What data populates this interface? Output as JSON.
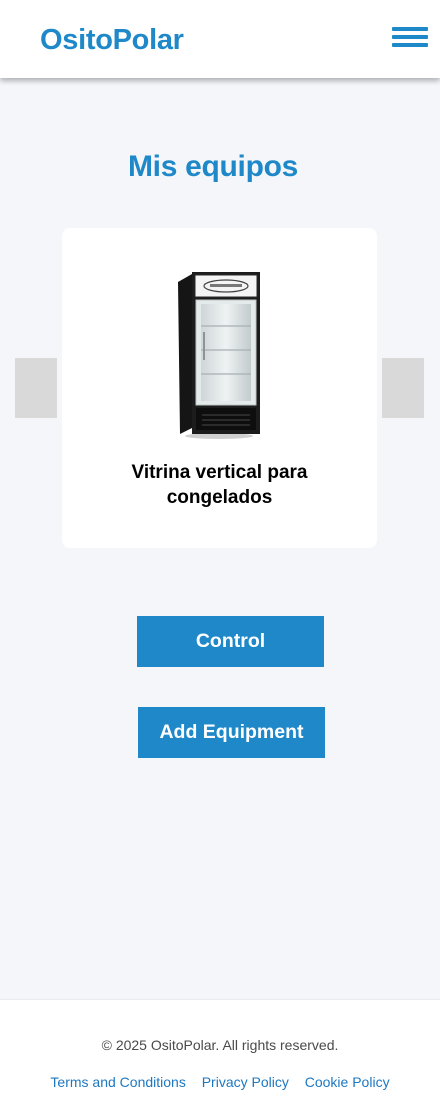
{
  "header": {
    "brand": "OsitoPolar",
    "menu_icon": "hamburger-menu-icon"
  },
  "main": {
    "title": "Mis equipos",
    "carousel": {
      "prev_icon": "chevron-left-icon",
      "next_icon": "chevron-right-icon",
      "current_item": {
        "name": "Vitrina vertical para congelados",
        "image": "vertical-freezer-display-icon"
      }
    },
    "control_button": "Control",
    "add_equipment_button": "Add Equipment"
  },
  "footer": {
    "copyright": "© 2025 OsitoPolar. All rights reserved.",
    "links": [
      "Terms and Conditions",
      "Privacy Policy",
      "Cookie Policy"
    ]
  },
  "colors": {
    "brand_blue": "#1e88c8",
    "background": "#f4f6fa",
    "card_background": "#ffffff",
    "arrow_gray": "#d9d9d9"
  }
}
